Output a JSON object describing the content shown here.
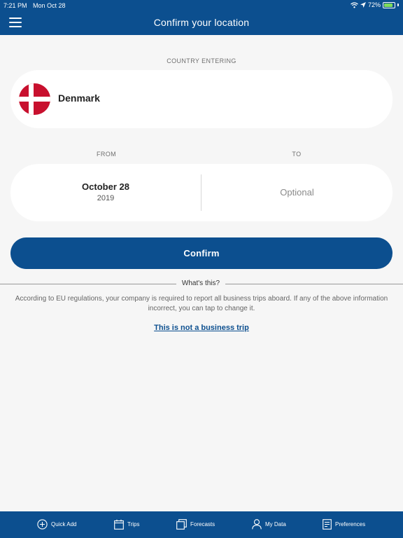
{
  "status": {
    "time": "7:21 PM",
    "date": "Mon Oct 28",
    "battery": "72%"
  },
  "header": {
    "title": "Confirm your location",
    "menu_icon": "hamburger-menu-icon"
  },
  "country": {
    "section_label": "COUNTRY ENTERING",
    "name": "Denmark",
    "flag_icon": "denmark-flag-icon"
  },
  "dates": {
    "from_label": "FROM",
    "to_label": "TO",
    "from_date": "October 28",
    "from_year": "2019",
    "to_placeholder": "Optional"
  },
  "actions": {
    "confirm_label": "Confirm"
  },
  "info": {
    "whats_this": "What's this?",
    "explanation": "According to EU regulations, your company is required to report all business trips aboard. If any of the above information incorrect, you can tap to change it.",
    "not_business_link": "This is not a business trip"
  },
  "tabs": [
    {
      "label": "Quick Add",
      "icon": "plus-circle-icon"
    },
    {
      "label": "Trips",
      "icon": "calendar-icon"
    },
    {
      "label": "Forecasts",
      "icon": "stacked-pages-icon"
    },
    {
      "label": "My Data",
      "icon": "person-icon"
    },
    {
      "label": "Preferences",
      "icon": "document-list-icon"
    }
  ],
  "colors": {
    "primary": "#0c4f8f",
    "background": "#f6f6f6",
    "flag_red": "#c8102e"
  }
}
